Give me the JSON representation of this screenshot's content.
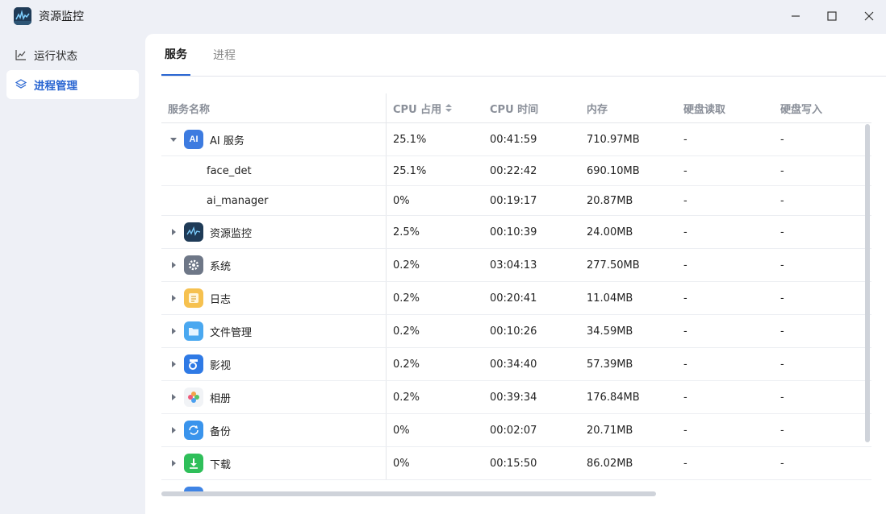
{
  "window": {
    "title": "资源监控",
    "app_icon": "resource-monitor-icon",
    "buttons": [
      "minimize-icon",
      "maximize-icon",
      "close-icon"
    ]
  },
  "sidebar": {
    "items": [
      {
        "label": "运行状态",
        "icon": "line-chart-icon",
        "active": false
      },
      {
        "label": "进程管理",
        "icon": "layers-icon",
        "active": true
      }
    ]
  },
  "tabs": [
    {
      "label": "服务",
      "active": true
    },
    {
      "label": "进程",
      "active": false
    }
  ],
  "table": {
    "columns": [
      "服务名称",
      "CPU 占用",
      "CPU 时间",
      "内存",
      "硬盘读取",
      "硬盘写入"
    ],
    "rows": [
      {
        "name": "AI 服务",
        "icon": "ai-icon",
        "expanded": true,
        "cpu": "25.1%",
        "cpu_time": "00:41:59",
        "mem": "710.97MB",
        "read": "-",
        "write": "-"
      },
      {
        "name": "face_det",
        "child": true,
        "cpu": "25.1%",
        "cpu_time": "00:22:42",
        "mem": "690.10MB",
        "read": "-",
        "write": "-"
      },
      {
        "name": "ai_manager",
        "child": true,
        "cpu": "0%",
        "cpu_time": "00:19:17",
        "mem": "20.87MB",
        "read": "-",
        "write": "-"
      },
      {
        "name": "资源监控",
        "icon": "resource-monitor-icon",
        "cpu": "2.5%",
        "cpu_time": "00:10:39",
        "mem": "24.00MB",
        "read": "-",
        "write": "-"
      },
      {
        "name": "系统",
        "icon": "gear-icon",
        "cpu": "0.2%",
        "cpu_time": "03:04:13",
        "mem": "277.50MB",
        "read": "-",
        "write": "-"
      },
      {
        "name": "日志",
        "icon": "log-icon",
        "cpu": "0.2%",
        "cpu_time": "00:20:41",
        "mem": "11.04MB",
        "read": "-",
        "write": "-"
      },
      {
        "name": "文件管理",
        "icon": "folder-icon",
        "cpu": "0.2%",
        "cpu_time": "00:10:26",
        "mem": "34.59MB",
        "read": "-",
        "write": "-"
      },
      {
        "name": "影视",
        "icon": "video-icon",
        "cpu": "0.2%",
        "cpu_time": "00:34:40",
        "mem": "57.39MB",
        "read": "-",
        "write": "-"
      },
      {
        "name": "相册",
        "icon": "photos-icon",
        "cpu": "0.2%",
        "cpu_time": "00:39:34",
        "mem": "176.84MB",
        "read": "-",
        "write": "-"
      },
      {
        "name": "备份",
        "icon": "backup-icon",
        "cpu": "0%",
        "cpu_time": "00:02:07",
        "mem": "20.71MB",
        "read": "-",
        "write": "-"
      },
      {
        "name": "下载",
        "icon": "download-icon",
        "cpu": "0%",
        "cpu_time": "00:15:50",
        "mem": "86.02MB",
        "read": "-",
        "write": "-"
      }
    ]
  },
  "colors": {
    "accent": "#2a66d2",
    "background": "#eef0f6",
    "panel": "#ffffff"
  }
}
